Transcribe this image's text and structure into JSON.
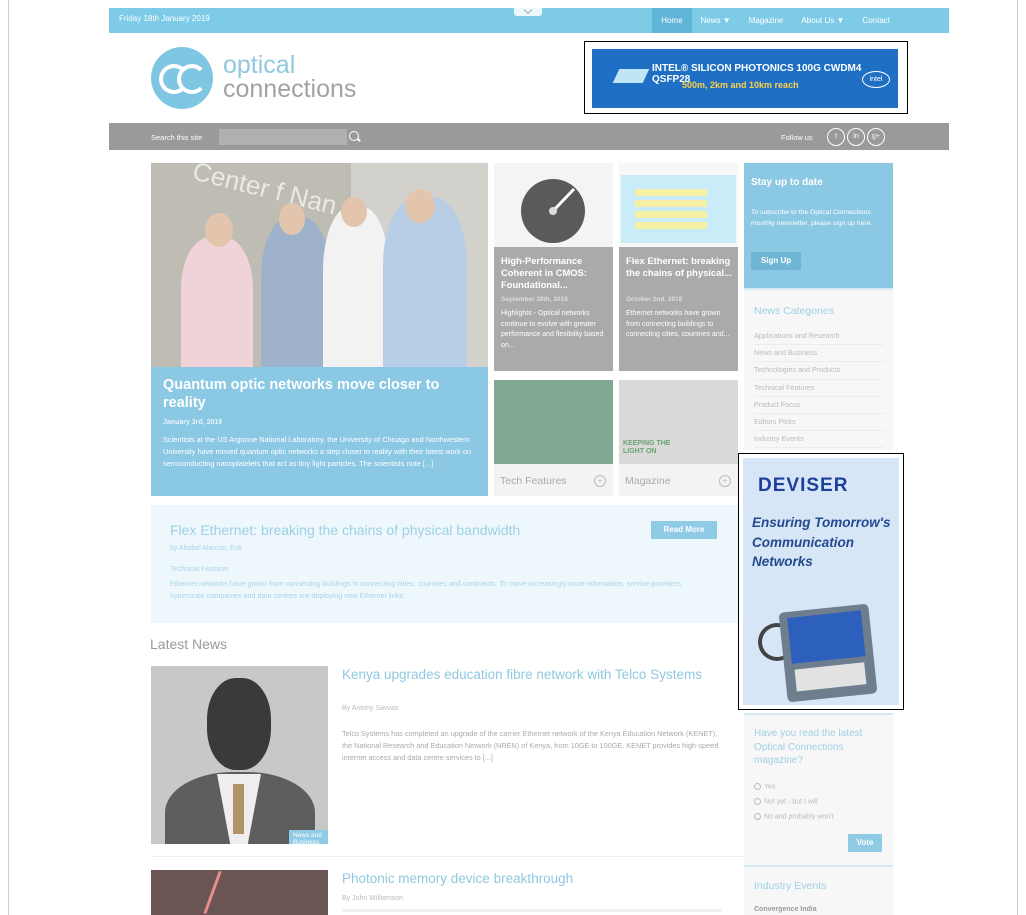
{
  "top": {
    "date": "Friday 18th January 2019",
    "nav": [
      "Home",
      "News ▼",
      "Magazine",
      "About Us ▼",
      "Contact"
    ]
  },
  "logo": {
    "line1": "optical",
    "line2": "connections"
  },
  "banner": {
    "line1": "INTEL® SILICON PHOTONICS 100G CWDM4 QSFP28",
    "line2": "500m, 2km and 10km reach",
    "brand": "intel"
  },
  "search": {
    "label": "Search this site",
    "placeholder": "",
    "follow": "Follow us",
    "social": [
      "t",
      "in",
      "g+"
    ]
  },
  "hero": {
    "title": "Quantum optic networks move closer to reality",
    "date": "January 3rd, 2019",
    "sign": "Center f Nan",
    "excerpt": "Scientists at the US Argonne National Laboratory, the University of Chicago and Northwestern University have moved quantum optic networks a step closer to reality with their latest work on semiconducting nanoplatelets that act as tiny light particles. The scientists note [...]"
  },
  "tiles": [
    {
      "title": "High-Performance Coherent in CMOS: Foundational...",
      "date": "September 30th, 2018",
      "excerpt": "Highlights - Optical networks continue to evolve with greater performance and flexibility based on..."
    },
    {
      "title": "Flex Ethernet: breaking the chains of physical...",
      "date": "October 2nd, 2018",
      "excerpt": "Ethernet networks have grown from connecting buildings to connecting cities, countries and..."
    }
  ],
  "cards": [
    {
      "label": "Tech Features"
    },
    {
      "label": "Magazine",
      "overlay": "KEEPING THE LIGHT ON"
    }
  ],
  "featured": {
    "title": "Flex Ethernet: breaking the chains of physical bandwidth",
    "by": "by Ahabel Alarcon, Extr",
    "button": "Read More",
    "category": "Technical Features",
    "excerpt": "Ethernet networks have grown from connecting buildings to connecting cities, countries and continents. To move increasingly more information, service providers, hyperscale companies and data centres are deploying new Ethernet links."
  },
  "latest": {
    "heading": "Latest News",
    "items": [
      {
        "title": "Kenya upgrades education fibre network with Telco Systems",
        "by": "By Antony Savvas",
        "badge": "News and Business",
        "excerpt": "Telco Systems has completed an upgrade of the carrier Ethernet network of the Kenya Education Network (KENET), the National Research and Education Network (NREN) of Kenya, from 10GE to 100GE. KENET provides high-speed internet access and data centre services to [...]"
      },
      {
        "title": "Photonic memory device breakthrough",
        "by": "By John Williamson"
      }
    ]
  },
  "sidebar": {
    "subscribe": {
      "heading": "Stay up to date",
      "text": "To subscribe to the Optical Connections monthly newsletter, please sign up here.",
      "button": "Sign Up"
    },
    "categories": {
      "heading": "News Categories",
      "items": [
        "Applications and Research",
        "News and Business",
        "Technologies and Products",
        "Technical Features",
        "Product Focus",
        "Editors Picks",
        "Industry Events"
      ]
    },
    "ad": {
      "brand": "DEVISER",
      "tagline": "Ensuring Tomorrow's Communication Networks"
    },
    "poll": {
      "question": "Have you read the latest Optical Connections magazine?",
      "options": [
        "Yes",
        "Not yet - but I will",
        "No and probably won't"
      ],
      "button": "Vote"
    },
    "events": {
      "heading": "Industry Events",
      "first": "Convergence India"
    }
  }
}
